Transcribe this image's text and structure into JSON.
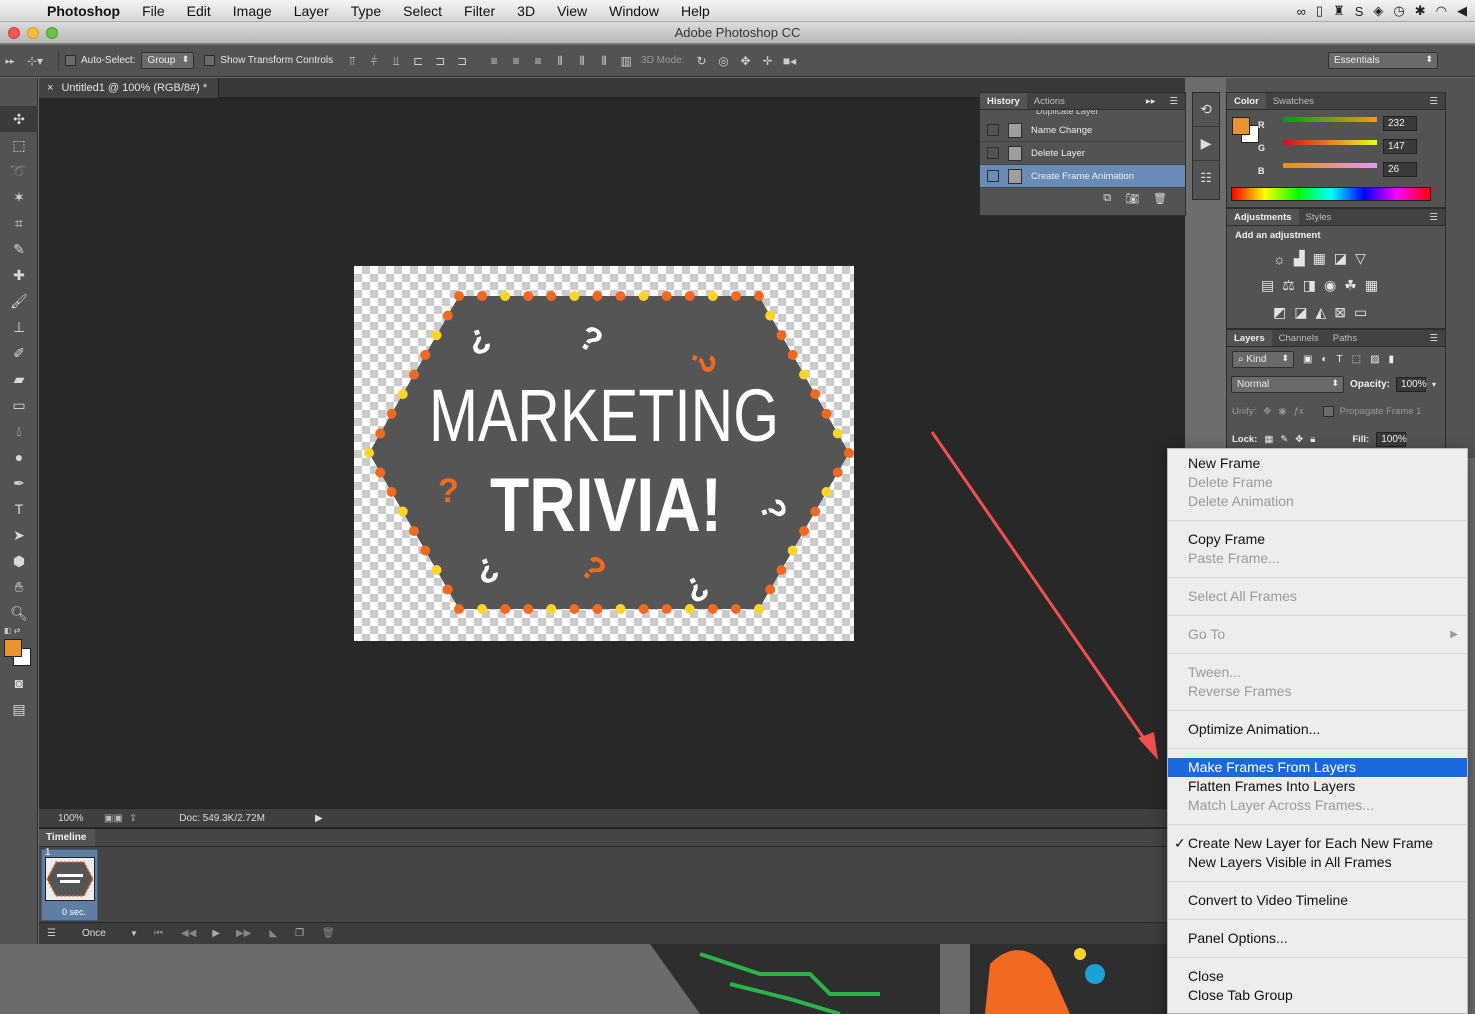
{
  "menubar": {
    "app": "Photoshop",
    "items": [
      "File",
      "Edit",
      "Image",
      "Layer",
      "Type",
      "Select",
      "Filter",
      "3D",
      "View",
      "Window",
      "Help"
    ]
  },
  "window": {
    "title": "Adobe Photoshop CC"
  },
  "options": {
    "auto_select_label": "Auto-Select:",
    "auto_select_value": "Group",
    "show_transform_label": "Show Transform Controls",
    "mode3d_label": "3D Mode:",
    "workspace": "Essentials"
  },
  "document": {
    "tab_title": "Untitled1 @ 100% (RGB/8#) *",
    "zoom": "100%",
    "doc_size": "Doc: 549.3K/2.72M",
    "artwork": {
      "line1": "MARKETING",
      "line2": "TRIVIA!"
    }
  },
  "timeline": {
    "tab": "Timeline",
    "frame_number": "1",
    "frame_delay": "0 sec.",
    "loop": "Once"
  },
  "history": {
    "tabs": [
      "History",
      "Actions"
    ],
    "cutoff_item": "Duplicate Layer",
    "items": [
      "Name Change",
      "Delete Layer",
      "Create Frame Animation"
    ]
  },
  "color_panel": {
    "tabs": [
      "Color",
      "Swatches"
    ],
    "foreground": "#e8932f",
    "channels": [
      {
        "label": "R",
        "value": "232"
      },
      {
        "label": "G",
        "value": "147"
      },
      {
        "label": "B",
        "value": "26"
      }
    ]
  },
  "adjustments_panel": {
    "tabs": [
      "Adjustments",
      "Styles"
    ],
    "heading": "Add an adjustment"
  },
  "layers_panel": {
    "tabs": [
      "Layers",
      "Channels",
      "Paths"
    ],
    "kind": "Kind",
    "blend": "Normal",
    "opacity_label": "Opacity:",
    "opacity": "100%",
    "unify_label": "Unify:",
    "propagate": "Propagate Frame 1",
    "lock_label": "Lock:",
    "fill_label": "Fill:",
    "fill": "100%"
  },
  "context_menu": {
    "groups": [
      [
        {
          "label": "New Frame",
          "enabled": true
        },
        {
          "label": "Delete Frame",
          "enabled": false
        },
        {
          "label": "Delete Animation",
          "enabled": false
        }
      ],
      [
        {
          "label": "Copy Frame",
          "enabled": true
        },
        {
          "label": "Paste Frame...",
          "enabled": false
        }
      ],
      [
        {
          "label": "Select All Frames",
          "enabled": false
        }
      ],
      [
        {
          "label": "Go To",
          "enabled": false,
          "submenu": true
        }
      ],
      [
        {
          "label": "Tween...",
          "enabled": false
        },
        {
          "label": "Reverse Frames",
          "enabled": false
        }
      ],
      [
        {
          "label": "Optimize Animation...",
          "enabled": true
        }
      ],
      [
        {
          "label": "Make Frames From Layers",
          "enabled": true,
          "highlighted": true
        },
        {
          "label": "Flatten Frames Into Layers",
          "enabled": true
        },
        {
          "label": "Match Layer Across Frames...",
          "enabled": false
        }
      ],
      [
        {
          "label": "Create New Layer for Each New Frame",
          "enabled": true,
          "checked": true
        },
        {
          "label": "New Layers Visible in All Frames",
          "enabled": true
        }
      ],
      [
        {
          "label": "Convert to Video Timeline",
          "enabled": true
        }
      ],
      [
        {
          "label": "Panel Options...",
          "enabled": true
        }
      ],
      [
        {
          "label": "Close",
          "enabled": true
        },
        {
          "label": "Close Tab Group",
          "enabled": true
        }
      ]
    ]
  },
  "colors": {
    "accent_orange": "#f26a21",
    "accent_yellow": "#ffd42a",
    "badge_gray": "#555555",
    "highlight": "#1a68df",
    "arrow": "#f05050"
  }
}
